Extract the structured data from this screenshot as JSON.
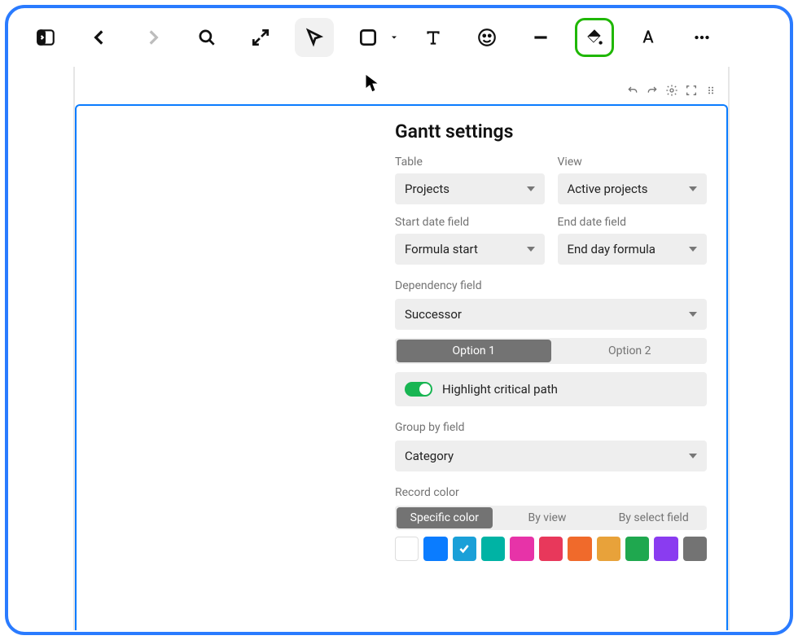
{
  "toolbar": {
    "icons": [
      "panel-toggle",
      "back",
      "forward",
      "search",
      "expand",
      "cursor",
      "shape",
      "text",
      "emoji",
      "line",
      "fill",
      "text-style",
      "more"
    ]
  },
  "mini_tools": [
    "undo",
    "redo",
    "settings",
    "focus",
    "drag-handle"
  ],
  "panel": {
    "title": "Gantt settings",
    "table": {
      "label": "Table",
      "value": "Projects"
    },
    "view": {
      "label": "View",
      "value": "Active projects"
    },
    "start_field": {
      "label": "Start date field",
      "value": "Formula start"
    },
    "end_field": {
      "label": "End date field",
      "value": "End day formula"
    },
    "dependency": {
      "label": "Dependency field",
      "value": "Successor"
    },
    "options": {
      "opt1": "Option 1",
      "opt2": "Option 2",
      "selected": "opt1"
    },
    "toggle": {
      "label": "Highlight critical path",
      "on": true
    },
    "group_by": {
      "label": "Group by field",
      "value": "Category"
    },
    "record_color": {
      "label": "Record color",
      "tabs": {
        "specific": "Specific color",
        "by_view": "By view",
        "by_select": "By select field",
        "selected": "specific"
      },
      "colors": [
        "#ffffff",
        "#0a7cff",
        "#1aa0d8",
        "#00b3a4",
        "#e733a8",
        "#e8385b",
        "#f06a2b",
        "#e8a23a",
        "#1fa84f",
        "#8a3cf0",
        "#737373"
      ],
      "selected_index": 2
    }
  }
}
